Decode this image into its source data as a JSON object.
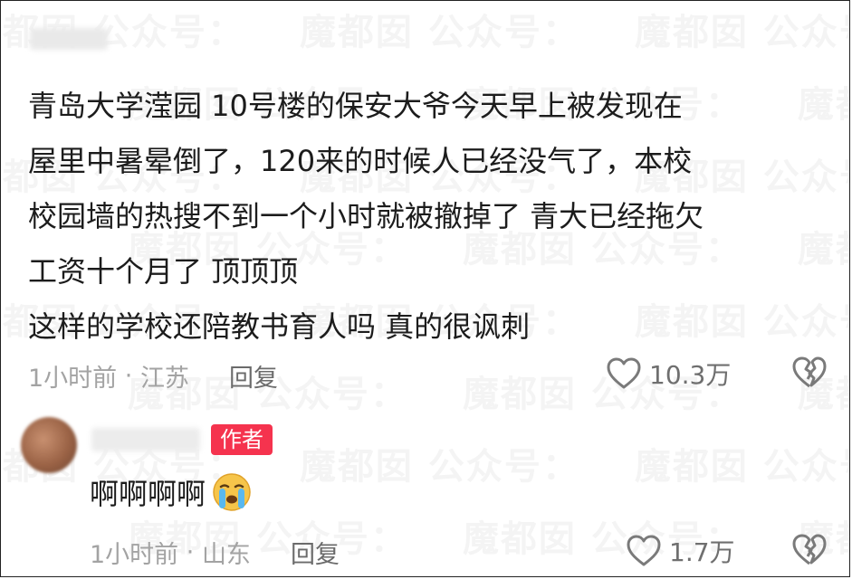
{
  "watermark": "魔都囡 公众号：",
  "comment": {
    "lines": [
      "青岛大学滢园   10号楼的保安大爷今天早上被发现在",
      "屋里中暑晕倒了，120来的时候人已经没气了，本校",
      "校园墙的热搜不到一个小时就被撤掉了 青大已经拖欠",
      "工资十个月了 顶顶顶",
      "这样的学校还陪教书育人吗 真的很讽刺"
    ],
    "time": "1小时前",
    "location": "江苏",
    "reply_label": "回复",
    "likes": "10.3万",
    "like_icon": "heart-outline-icon",
    "dislike_icon": "broken-heart-icon"
  },
  "reply": {
    "badge": "作者",
    "text": "啊啊啊啊",
    "emoji": "😭",
    "time": "1小时前",
    "location": "山东",
    "reply_label": "回复",
    "likes": "1.7万"
  },
  "colors": {
    "badge": "#f5334e",
    "meta": "#a3a3a3"
  }
}
